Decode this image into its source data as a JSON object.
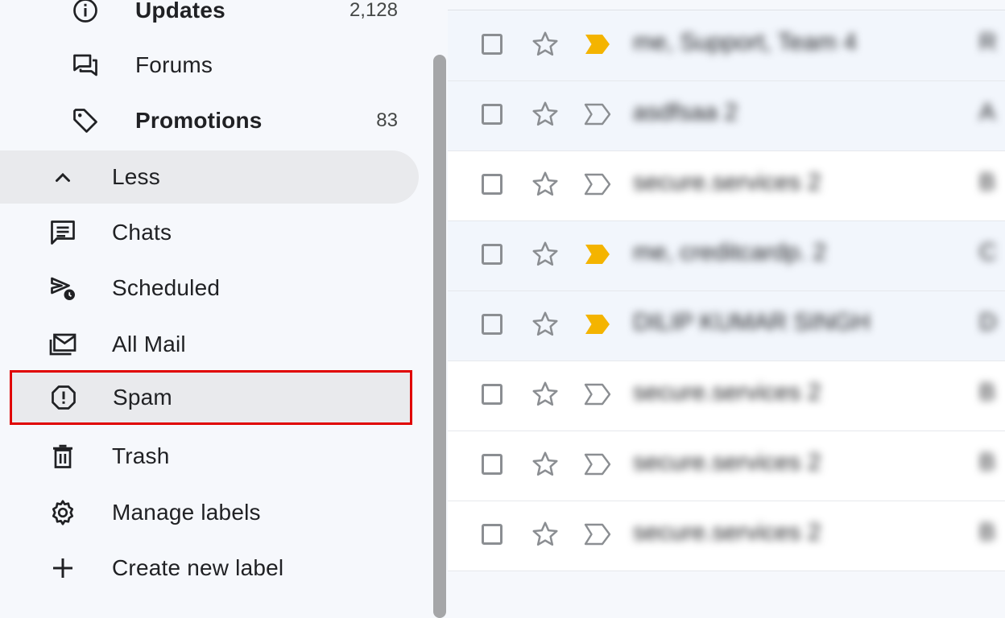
{
  "sidebar": {
    "categories": [
      {
        "label": "Updates",
        "count": "2,128",
        "icon": "info-icon"
      },
      {
        "label": "Forums",
        "count": "",
        "icon": "forum-icon"
      },
      {
        "label": "Promotions",
        "count": "83",
        "icon": "tag-icon"
      }
    ],
    "less_label": "Less",
    "items": [
      {
        "label": "Chats",
        "icon": "chat-icon"
      },
      {
        "label": "Scheduled",
        "icon": "scheduled-send-icon"
      },
      {
        "label": "All Mail",
        "icon": "all-mail-icon"
      },
      {
        "label": "Spam",
        "icon": "spam-icon"
      },
      {
        "label": "Trash",
        "icon": "trash-icon"
      },
      {
        "label": "Manage labels",
        "icon": "gear-icon"
      },
      {
        "label": "Create new label",
        "icon": "plus-icon"
      }
    ]
  },
  "colors": {
    "highlight_border": "#e00000",
    "important_marker": "#f4b400"
  },
  "mail_rows": [
    {
      "sender": "me, Support, Team 4",
      "snippet": "R",
      "important": true,
      "unread": false
    },
    {
      "sender": "asdfsaa 2",
      "snippet": "A",
      "important": false,
      "unread": false
    },
    {
      "sender": "secure.services 2",
      "snippet": "B",
      "important": false,
      "unread": true
    },
    {
      "sender": "me, creditcardp. 2",
      "snippet": "C",
      "important": true,
      "unread": false
    },
    {
      "sender": "DILIP KUMAR SINGH",
      "snippet": "D",
      "important": true,
      "unread": false
    },
    {
      "sender": "secure.services 2",
      "snippet": "B",
      "important": false,
      "unread": true
    },
    {
      "sender": "secure.services 2",
      "snippet": "B",
      "important": false,
      "unread": true
    },
    {
      "sender": "secure.services 2",
      "snippet": "B",
      "important": false,
      "unread": true
    }
  ]
}
